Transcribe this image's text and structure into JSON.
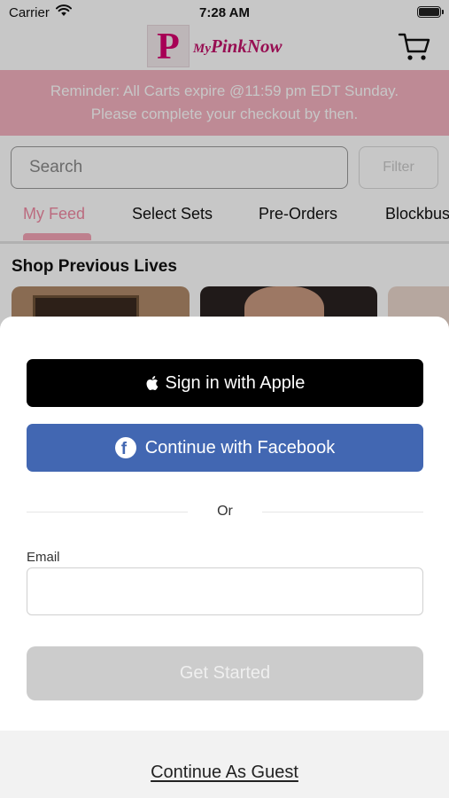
{
  "status_bar": {
    "carrier": "Carrier",
    "time": "7:28 AM"
  },
  "header": {
    "logo_letter": "P",
    "logo_my": "My",
    "logo_name": "PinkNow",
    "cart_icon": "cart-icon"
  },
  "reminder": {
    "line1": "Reminder: All Carts expire @11:59 pm EDT Sunday.",
    "line2": "Please complete your checkout by then."
  },
  "search": {
    "placeholder": "Search",
    "filter_label": "Filter"
  },
  "tabs": [
    {
      "label": "My Feed",
      "active": true
    },
    {
      "label": "Select Sets",
      "active": false
    },
    {
      "label": "Pre-Orders",
      "active": false
    },
    {
      "label": "Blockbus",
      "active": false
    }
  ],
  "section": {
    "title": "Shop Previous Lives"
  },
  "sheet": {
    "apple_label": "Sign in with Apple",
    "facebook_label": "Continue with Facebook",
    "or_text": "Or",
    "email_label": "Email",
    "email_value": "",
    "get_started_label": "Get Started",
    "guest_label": "Continue As Guest"
  },
  "colors": {
    "brand_pink": "#d6006d",
    "reminder_bg": "#f4b1bf",
    "facebook_blue": "#4267b2",
    "disabled_button": "#cccccc"
  }
}
